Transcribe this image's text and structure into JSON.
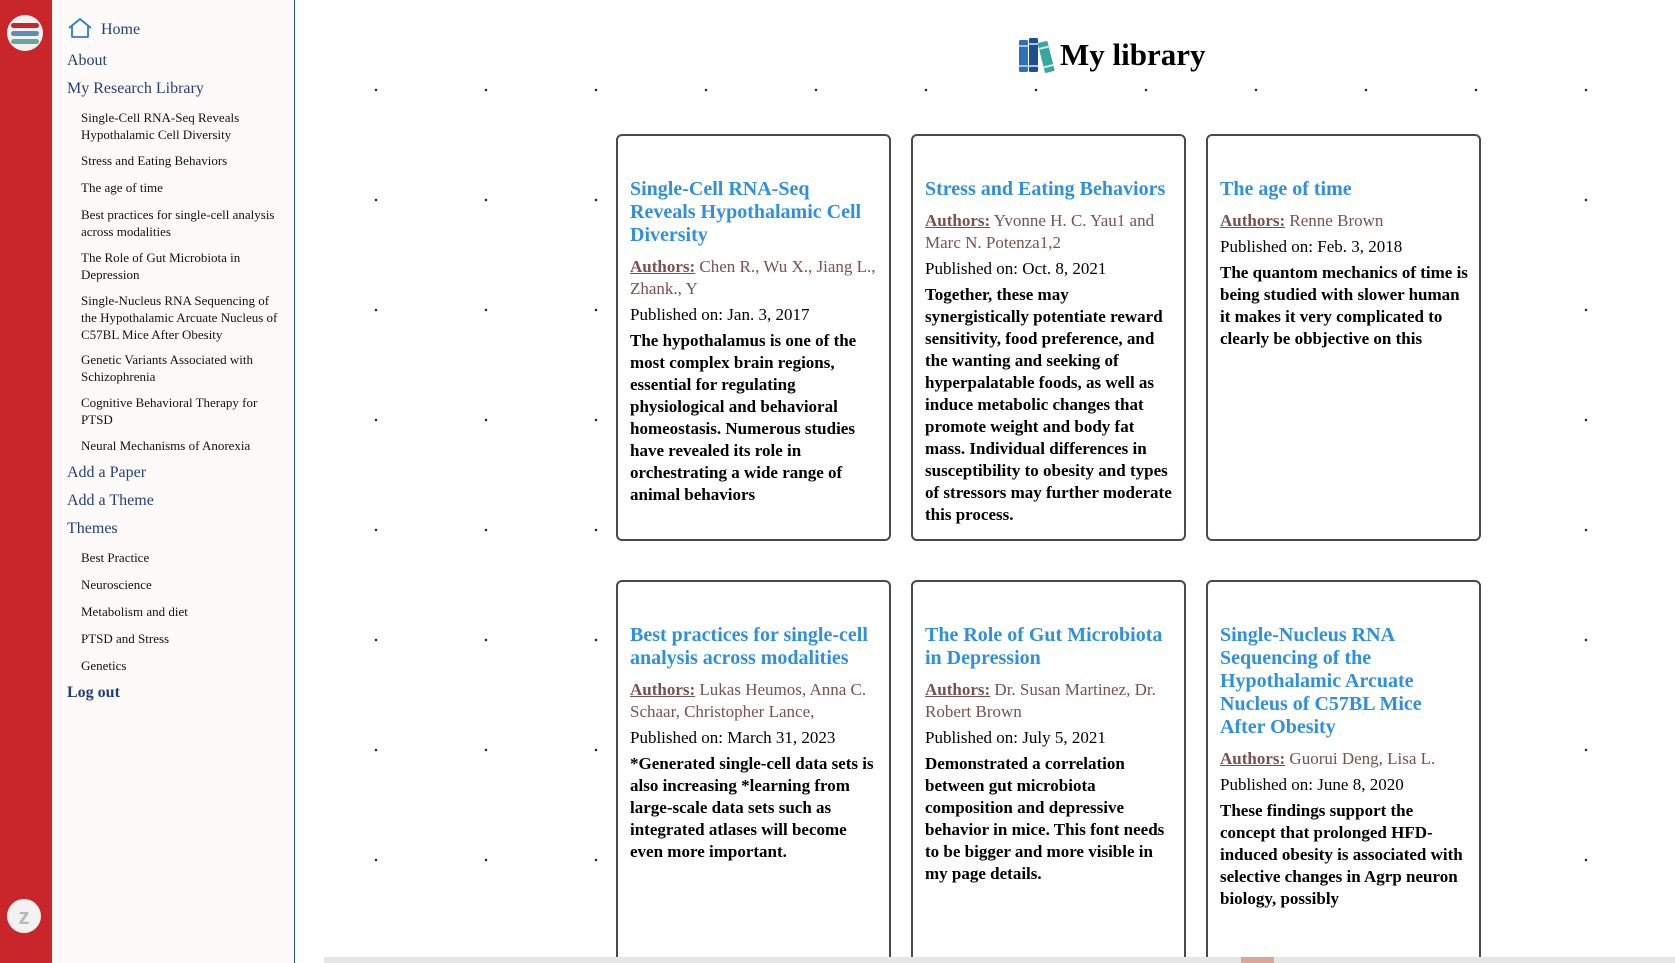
{
  "rail": {
    "logo_icon": "books-logo-icon",
    "user_initial": "z"
  },
  "sidebar": {
    "home": "Home",
    "about": "About",
    "library": "My Research Library",
    "papers": [
      "Single-Cell RNA-Seq Reveals Hypothalamic Cell Diversity",
      "Stress and Eating Behaviors",
      "The age of time",
      "Best practices for single-cell analysis across modalities",
      "The Role of Gut Microbiota in Depression",
      "Single-Nucleus RNA Sequencing of the Hypothalamic Arcuate Nucleus of C57BL Mice After Obesity",
      "Genetic Variants Associated with Schizophrenia",
      "Cognitive Behavioral Therapy for PTSD",
      "Neural Mechanisms of Anorexia"
    ],
    "add_paper": "Add a Paper",
    "add_theme": "Add a Theme",
    "themes_label": "Themes",
    "themes": [
      "Best Practice",
      "Neuroscience",
      "Metabolism and diet",
      "PTSD and Stress",
      "Genetics"
    ],
    "logout": "Log out"
  },
  "main": {
    "title": "My library",
    "authors_label": "Authors:",
    "published_label": "Published on:",
    "cards": [
      {
        "title": "Single-Cell RNA-Seq Reveals Hypothalamic Cell Diversity",
        "authors": "Chen R., Wu X., Jiang L., Zhank., Y",
        "published": "Jan. 3, 2017",
        "abstract": "The hypothalamus is one of the most complex brain regions, essential for regulating physiological and behavioral homeostasis. Numerous studies have revealed its role in orchestrating a wide range of animal behaviors"
      },
      {
        "title": "Stress and Eating Behaviors",
        "authors": "Yvonne H. C. Yau1 and Marc N. Potenza1,2",
        "published": "Oct. 8, 2021",
        "abstract": "Together, these may synergistically potentiate reward sensitivity, food preference, and the wanting and seeking of hyperpalatable foods, as well as induce metabolic changes that promote weight and body fat mass. Individual differences in susceptibility to obesity and types of stressors may further moderate this process."
      },
      {
        "title": "The age of time",
        "authors": "Renne Brown",
        "published": "Feb. 3, 2018",
        "abstract": "The quantom mechanics of time is being studied with slower human it makes it very complicated to clearly be obbjective on this"
      },
      {
        "title": "Best practices for single-cell analysis across modalities",
        "authors": "Lukas Heumos, Anna C. Schaar, Christopher Lance,",
        "published": "March 31, 2023",
        "abstract": "*Generated single-cell data sets is also increasing *learning from large-scale data sets such as integrated atlases will become even more important."
      },
      {
        "title": "The Role of Gut Microbiota in Depression",
        "authors": "Dr. Susan Martinez, Dr. Robert Brown",
        "published": "July 5, 2021",
        "abstract": "Demonstrated a correlation between gut microbiota composition and depressive behavior in mice. This font needs to be bigger and more visible in my page details."
      },
      {
        "title": "Single-Nucleus RNA Sequencing of the Hypothalamic Arcuate Nucleus of C57BL Mice After Obesity",
        "authors": "Guorui Deng, Lisa L.",
        "published": "June 8, 2020",
        "abstract": "These findings support the concept that prolonged HFD-induced obesity is associated with selective changes in Agrp neuron biology, possibly"
      }
    ]
  }
}
